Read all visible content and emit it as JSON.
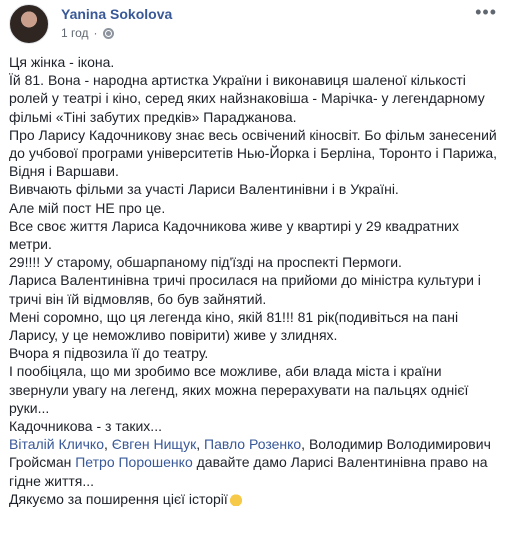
{
  "post": {
    "author": "Yanina Sokolova",
    "time": "1 год",
    "dot": "·",
    "more_label": "•••",
    "paragraphs": [
      "Ця жінка - ікона.",
      "Їй 81. Вона - народна артистка України і виконавиця шаленої кількості ролей у театрі і кіно, серед яких найзнаковіша - Марічка- у легендарному фільмі «Тіні забутих предків» Параджанова.",
      "Про Ларису Кадочникову знає весь освічений кіносвіт. Бо фільм занесений до учбової програми університетів Нью-Йорка і Берліна, Торонто і Парижа, Відня і Варшави.",
      "Вивчають фільми за участі Лариси Валентинівни і в Україні.",
      "Але мій пост НЕ про це.",
      "Все своє життя Лариса Кадочникова живе у квартирі у 29 квадратних метри.",
      "29!!!! У старому, обшарпаному під'їзді на проспекті Пермоги.",
      "Лариса Валентинівна тричі просилася на прийоми до міністра культури і тричі він їй відмовляв, бо був зайнятий.",
      "Мені соромно, що ця легенда кіно, якій 81!!! 81 рік(подивіться на пані Ларису, у це неможливо повірити) живе у злиднях.",
      "Вчора я підвозила її до театру.",
      "І пообіцяла, що ми зробимо все можливе, аби влада міста і країни звернули увагу на легенд, яких можна перерахувати на пальцях однієї руки...",
      "Кадочникова - з таких..."
    ],
    "mentions": {
      "m1": "Віталій Кличко",
      "sep1": ", ",
      "m2": "Євген Нищук",
      "sep2": ", ",
      "m3": "Павло Розенко",
      "plain1": ", Володимир Володимирович Гройсман ",
      "m4": "Петро Порошенко",
      "plain2": " давайте дамо Ларисі Валентинівна право на гідне життя..."
    },
    "closing": "Дякуємо за поширення цієї історії",
    "link_color": "#385898"
  }
}
